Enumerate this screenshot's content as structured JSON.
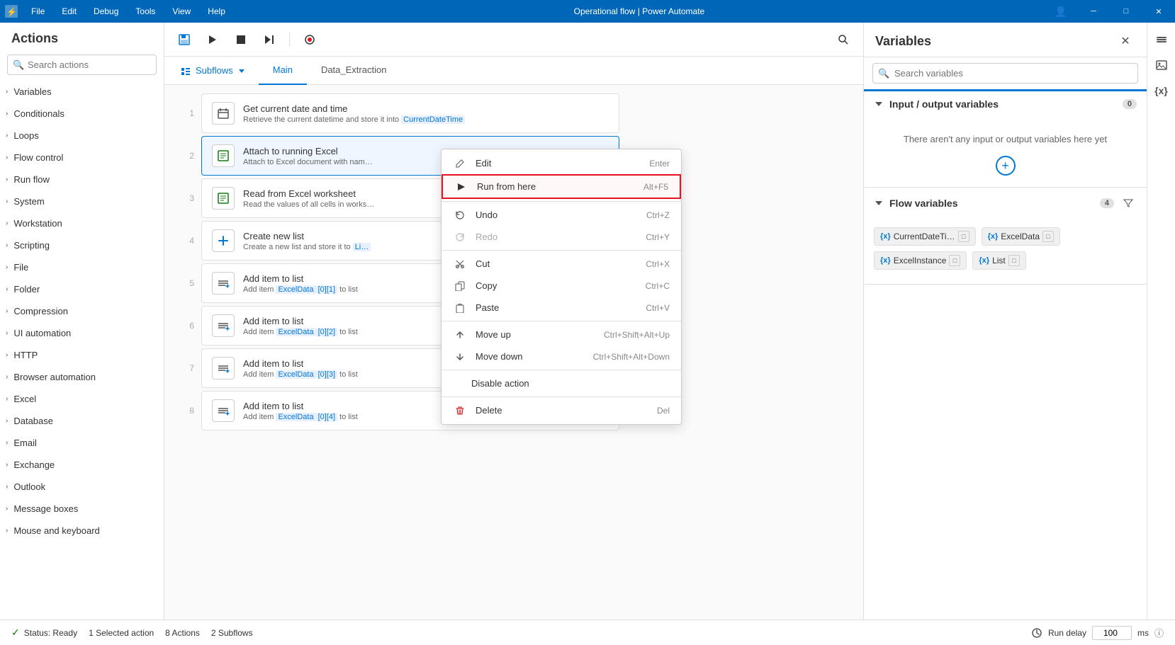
{
  "titlebar": {
    "menu_items": [
      "File",
      "Edit",
      "Debug",
      "Tools",
      "View",
      "Help"
    ],
    "title": "Operational flow | Power Automate",
    "controls": {
      "minimize": "─",
      "maximize": "□",
      "close": "✕"
    }
  },
  "actions_panel": {
    "heading": "Actions",
    "search_placeholder": "Search actions",
    "categories": [
      {
        "id": "variables",
        "label": "Variables"
      },
      {
        "id": "conditionals",
        "label": "Conditionals"
      },
      {
        "id": "loops",
        "label": "Loops"
      },
      {
        "id": "flow-control",
        "label": "Flow control"
      },
      {
        "id": "run-flow",
        "label": "Run flow"
      },
      {
        "id": "system",
        "label": "System"
      },
      {
        "id": "workstation",
        "label": "Workstation"
      },
      {
        "id": "scripting",
        "label": "Scripting"
      },
      {
        "id": "file",
        "label": "File"
      },
      {
        "id": "folder",
        "label": "Folder"
      },
      {
        "id": "compression",
        "label": "Compression"
      },
      {
        "id": "ui-automation",
        "label": "UI automation"
      },
      {
        "id": "http",
        "label": "HTTP"
      },
      {
        "id": "browser-automation",
        "label": "Browser automation"
      },
      {
        "id": "excel",
        "label": "Excel"
      },
      {
        "id": "database",
        "label": "Database"
      },
      {
        "id": "email",
        "label": "Email"
      },
      {
        "id": "exchange",
        "label": "Exchange"
      },
      {
        "id": "outlook",
        "label": "Outlook"
      },
      {
        "id": "message-boxes",
        "label": "Message boxes"
      },
      {
        "id": "mouse-keyboard",
        "label": "Mouse and keyboard"
      }
    ]
  },
  "toolbar": {
    "save_icon": "💾",
    "run_icon": "▶",
    "stop_icon": "■",
    "step_icon": "⏭",
    "record_icon": "⏺",
    "search_icon": "🔍"
  },
  "subflows": {
    "label": "Subflows",
    "tabs": [
      {
        "id": "main",
        "label": "Main",
        "active": true
      },
      {
        "id": "data-extraction",
        "label": "Data_Extraction",
        "active": false
      }
    ]
  },
  "flow_steps": [
    {
      "number": 1,
      "title": "Get current date and time",
      "description": "Retrieve the current datetime and store it into",
      "var_badge": "CurrentDateTime",
      "icon": "📅"
    },
    {
      "number": 2,
      "title": "Attach to running Excel",
      "description": "Attach to Excel document with nam…",
      "var_badge": null,
      "icon": "📊",
      "selected": true
    },
    {
      "number": 3,
      "title": "Read from Excel worksheet",
      "description": "Read the values of all cells in works…",
      "var_badge": null,
      "icon": "📊"
    },
    {
      "number": 4,
      "title": "Create new list",
      "description": "Create a new list and store it to",
      "var_badge": "Li…",
      "icon": "➕"
    },
    {
      "number": 5,
      "title": "Add item to list",
      "description": "Add item ExcelData [0][1] to list",
      "var_badge": null,
      "icon": "≡+"
    },
    {
      "number": 6,
      "title": "Add item to list",
      "description": "Add item ExcelData [0][2] to list",
      "var_badge": null,
      "icon": "≡+"
    },
    {
      "number": 7,
      "title": "Add item to list",
      "description": "Add item ExcelData [0][3] to list",
      "var_badge": null,
      "icon": "≡+"
    },
    {
      "number": 8,
      "title": "Add item to list",
      "description": "Add item ExcelData [0][4] to list",
      "var_badge": null,
      "icon": "≡+"
    }
  ],
  "context_menu": {
    "items": [
      {
        "id": "edit",
        "icon": "✏️",
        "label": "Edit",
        "shortcut": "Enter",
        "disabled": false,
        "highlighted": false,
        "separator_after": false
      },
      {
        "id": "run-from-here",
        "icon": "▶",
        "label": "Run from here",
        "shortcut": "Alt+F5",
        "disabled": false,
        "highlighted": true,
        "separator_after": true
      },
      {
        "id": "undo",
        "icon": "↩",
        "label": "Undo",
        "shortcut": "Ctrl+Z",
        "disabled": false,
        "highlighted": false,
        "separator_after": false
      },
      {
        "id": "redo",
        "icon": "↪",
        "label": "Redo",
        "shortcut": "Ctrl+Y",
        "disabled": true,
        "highlighted": false,
        "separator_after": true
      },
      {
        "id": "cut",
        "icon": "✂",
        "label": "Cut",
        "shortcut": "Ctrl+X",
        "disabled": false,
        "highlighted": false,
        "separator_after": false
      },
      {
        "id": "copy",
        "icon": "📋",
        "label": "Copy",
        "shortcut": "Ctrl+C",
        "disabled": false,
        "highlighted": false,
        "separator_after": false
      },
      {
        "id": "paste",
        "icon": "📌",
        "label": "Paste",
        "shortcut": "Ctrl+V",
        "disabled": false,
        "highlighted": false,
        "separator_after": true
      },
      {
        "id": "move-up",
        "icon": "↑",
        "label": "Move up",
        "shortcut": "Ctrl+Shift+Alt+Up",
        "disabled": false,
        "highlighted": false,
        "separator_after": false
      },
      {
        "id": "move-down",
        "icon": "↓",
        "label": "Move down",
        "shortcut": "Ctrl+Shift+Alt+Down",
        "disabled": false,
        "highlighted": false,
        "separator_after": true
      },
      {
        "id": "disable",
        "icon": "",
        "label": "Disable action",
        "shortcut": "",
        "disabled": false,
        "highlighted": false,
        "separator_after": true
      },
      {
        "id": "delete",
        "icon": "🗑",
        "label": "Delete",
        "shortcut": "Del",
        "disabled": false,
        "highlighted": false,
        "separator_after": false
      }
    ]
  },
  "variables_panel": {
    "heading": "Variables",
    "search_placeholder": "Search variables",
    "sections": [
      {
        "id": "input-output",
        "title": "Input / output variables",
        "count": 0,
        "empty_text": "There aren't any input or output variables here yet",
        "show_add": true,
        "variables": []
      },
      {
        "id": "flow-variables",
        "title": "Flow variables",
        "count": 4,
        "show_add": false,
        "variables": [
          {
            "name": "CurrentDateTi…",
            "label": "{x}"
          },
          {
            "name": "ExcelData",
            "label": "{x}"
          },
          {
            "name": "ExcelInstance",
            "label": "{x}"
          },
          {
            "name": "List",
            "label": "{x}"
          }
        ]
      }
    ]
  },
  "status_bar": {
    "status": "Status: Ready",
    "selected_action": "1 Selected action",
    "actions_count": "8 Actions",
    "subflows_count": "2 Subflows",
    "run_delay_label": "Run delay",
    "run_delay_value": "100",
    "ms_label": "ms"
  }
}
